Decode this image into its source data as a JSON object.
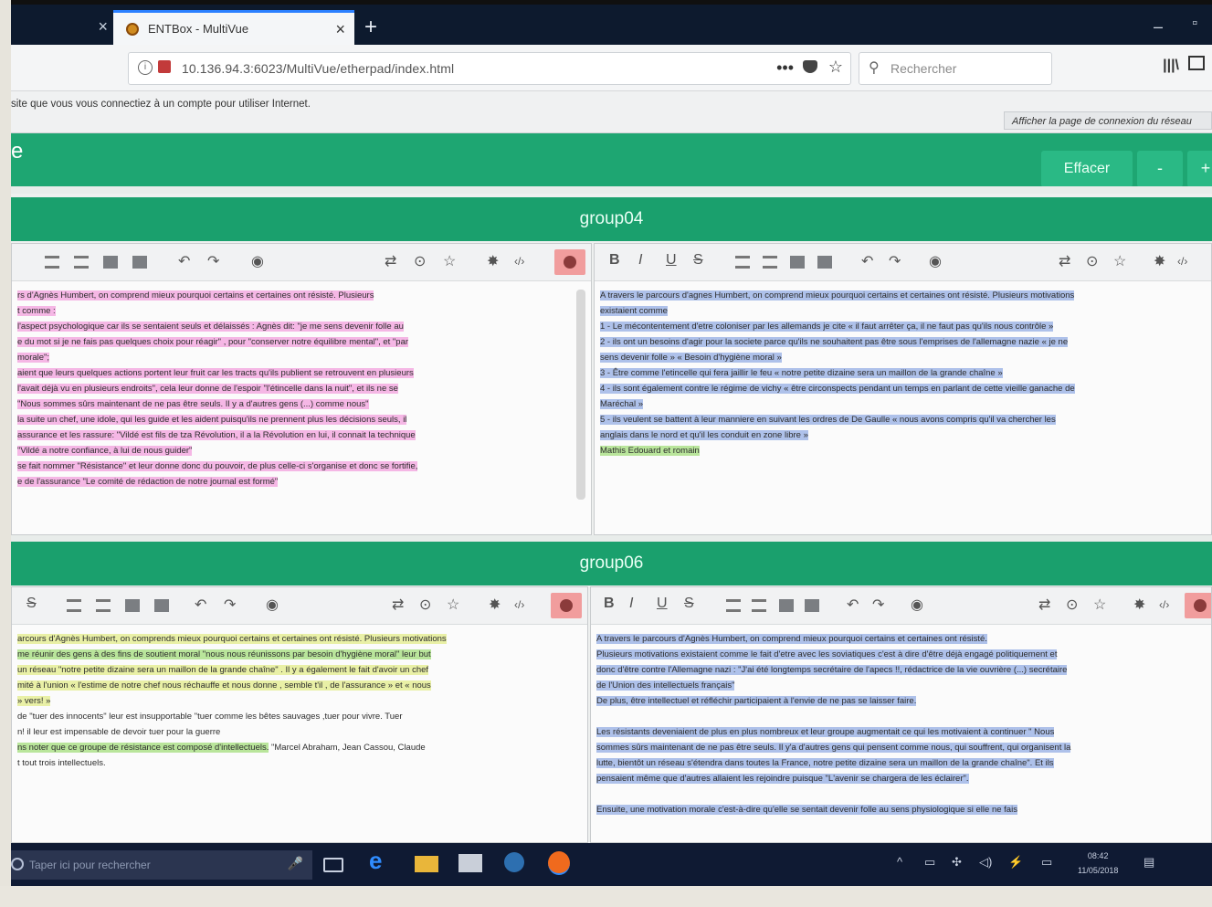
{
  "browser": {
    "prev_tab_close": "×",
    "active_tab_title": "ENTBox - MultiVue",
    "active_tab_close": "×",
    "new_tab": "+",
    "url": "10.136.94.3:6023/MultiVue/etherpad/index.html",
    "page_actions": "•••",
    "search_placeholder": "Rechercher",
    "min": "–",
    "max": "▫"
  },
  "notification": {
    "message": "site que vous vous connectiez à un compte pour utiliser Internet.",
    "action": "Afficher la page de connexion du réseau"
  },
  "app": {
    "brand_fragment": "e",
    "clear_label": "Effacer",
    "minus_label": "-",
    "plus_label": "+"
  },
  "toolbar_glyphs": {
    "bold": "B",
    "italic": "I",
    "underline": "U",
    "strike": "S",
    "undo": "↶",
    "redo": "↷",
    "eye": "◉",
    "sync": "⇄",
    "clock": "⊙",
    "star": "☆",
    "gear": "✸",
    "embed": "‹/›"
  },
  "groups": [
    {
      "name": "group04",
      "left_pad": [
        {
          "text": "rs d'Agnès Humbert, on comprend mieux pourquoi certains et certaines ont résisté. Plusieurs",
          "hl": "pink"
        },
        {
          "text": "t comme :",
          "hl": "pink"
        },
        {
          "text": "l'aspect psychologique car ils se sentaient seuls et délaissés : Agnès dit: \"je me sens devenir folle au",
          "hl": "pink"
        },
        {
          "text": "e du mot si je ne fais pas quelques choix pour réagir\" , pour \"conserver notre équilibre mental\", et \"par",
          "hl": "pink"
        },
        {
          "text": "morale\";",
          "hl": "pink"
        },
        {
          "text": "aient que leurs quelques actions portent leur fruit car les tracts qu'ils publient se retrouvent en plusieurs",
          "hl": "pink"
        },
        {
          "text": "l'avait déjà vu en plusieurs endroits\", cela leur donne de l'espoir \"l'étincelle dans la nuit\", et ils ne se",
          "hl": "pink"
        },
        {
          "text": "\"Nous sommes sûrs maintenant de ne pas être seuls. Il y a d'autres gens (...) comme nous\"",
          "hl": "pink"
        },
        {
          "text": "la suite un chef, une idole, qui les guide et les aident puisqu'ils ne prennent plus les décisions seuls, il",
          "hl": "pink"
        },
        {
          "text": "assurance et les rassure: \"Vildé est fils de tza Révolution, il a la Révolution en lui, il connait la technique",
          "hl": "pink"
        },
        {
          "text": "\"Vildé a notre confiance, à lui de nous guider\"",
          "hl": "pink"
        },
        {
          "text": "se fait nommer \"Résistance\" et leur donne donc du pouvoir, de plus celle-ci s'organise et donc se fortifie,",
          "hl": "pink"
        },
        {
          "text": "e de l'assurance \"Le comité de rédaction de notre journal est formé\"",
          "hl": "pink"
        }
      ],
      "right_pad": [
        {
          "text": "A travers le parcours d'agnes Humbert, on comprend mieux pourquoi certains et certaines ont résisté. Plusieurs motivations",
          "hl": "blue"
        },
        {
          "text": "existaient comme",
          "hl": "blue"
        },
        {
          "text": "1 - Le mécontentement d'etre coloniser par les allemands je cite « il faut arrêter ça, il ne faut pas qu'ils nous contrôle »",
          "hl": "blue"
        },
        {
          "text": "2 - ils ont un besoins d'agir pour la societe parce qu'ils ne souhaitent pas être sous l'emprises de l'allemagne nazie « je ne",
          "hl": "blue"
        },
        {
          "text": "sens devenir folle » « Besoin d'hygiène moral »",
          "hl": "blue"
        },
        {
          "text": "3 - Être comme l'etincelle qui fera jaillir le feu « notre petite dizaine sera un maillon de la grande chaîne »",
          "hl": "blue"
        },
        {
          "text": "4 - ils sont également contre le régime de vichy « être circonspects pendant un temps en parlant de cette vieille ganache de",
          "hl": "blue"
        },
        {
          "text": "Maréchal »",
          "hl": "blue"
        },
        {
          "text": "5 - ils veulent se battent à leur manniere en suivant les ordres de De Gaulle « nous avons compris qu'il va chercher les",
          "hl": "blue"
        },
        {
          "text": "anglais dans le nord et qu'il les conduit en zone libre »",
          "hl": "blue"
        },
        {
          "text": "Mathis Edouard et romain",
          "hl": "green"
        }
      ]
    },
    {
      "name": "group06",
      "left_pad": [
        {
          "text": "arcours d'Agnès Humbert, on comprends mieux pourquoi certains et certaines ont résisté. Plusieurs motivations",
          "hl": "yellow"
        },
        {
          "text": "me réunir des gens à des fins de soutient moral \"nous nous réunissons par besoin d'hygiène moral\" leur but",
          "hl": "green"
        },
        {
          "text": "un réseau \"notre petite dizaine sera un maillon de la grande chaîne\" . Il y a également le fait d'avoir un chef",
          "hl": "yellow"
        },
        {
          "text": "mité à l'union « l'estime de notre chef nous réchauffe et nous donne , semble t'il , de l'assurance » et « nous",
          "hl": "yellow"
        },
        {
          "text": "» vers! »",
          "hl": "yellow"
        },
        {
          "text": "de \"tuer des innocents\" leur est insupportable \"tuer comme les bêtes sauvages ,tuer pour vivre. Tuer",
          "hl": "none"
        },
        {
          "text": "n! il leur est impensable de devoir tuer pour la guerre",
          "hl": "none"
        },
        {
          "text": "ns noter que ce groupe de résistance est composé d'intellectuels.",
          "hl": "green",
          "tail": " \"Marcel Abraham, Jean Cassou, Claude"
        },
        {
          "text": "t tout trois intellectuels.",
          "hl": "none"
        }
      ],
      "right_pad": [
        {
          "text": "A travers le parcours d'Agnès Humbert, on comprend mieux pourquoi certains et certaines ont résisté.",
          "hl": "blue"
        },
        {
          "text": "Plusieurs motivations existaient comme le fait d'etre avec les soviatiques c'est à dire d'être déjà engagé politiquement et",
          "hl": "blue"
        },
        {
          "text": "donc d'être contre l'Allemagne nazi : \"J'ai été longtemps secrétaire de l'apecs !!, rédactrice de la vie ouvrière (...) secrétaire",
          "hl": "blue"
        },
        {
          "text": "de l'Union des intellectuels français\"",
          "hl": "blue"
        },
        {
          "text": "De plus, être intellectuel et réfléchir participaient à l'envie de ne pas se laisser faire.",
          "hl": "blue"
        },
        {
          "text": "",
          "hl": "none"
        },
        {
          "text": "Les résistants deveniaient de plus en plus nombreux et leur groupe augmentait ce qui les motivaient à continuer \" Nous",
          "hl": "blue"
        },
        {
          "text": "sommes sûrs maintenant de ne pas être seuls. Il y'a d'autres gens qui pensent comme nous, qui souffrent, qui organisent la",
          "hl": "blue"
        },
        {
          "text": "lutte, bientôt un réseau s'étendra dans toutes la France, notre petite dizaine sera un maillon de la grande chaîne\". Et ils",
          "hl": "blue"
        },
        {
          "text": "pensaient même que d'autres allaient les rejoindre puisque \"L'avenir se chargera de les éclairer\".",
          "hl": "blue"
        },
        {
          "text": "",
          "hl": "none"
        },
        {
          "text": "Ensuite, une motivation morale c'est-à-dire qu'elle se sentait devenir folle au sens physiologique si elle ne fais",
          "hl": "blue"
        }
      ]
    }
  ],
  "taskbar": {
    "search_placeholder": "Taper ici pour rechercher",
    "mic": "🎤",
    "time": "08:42",
    "date": "11/05/2018"
  }
}
